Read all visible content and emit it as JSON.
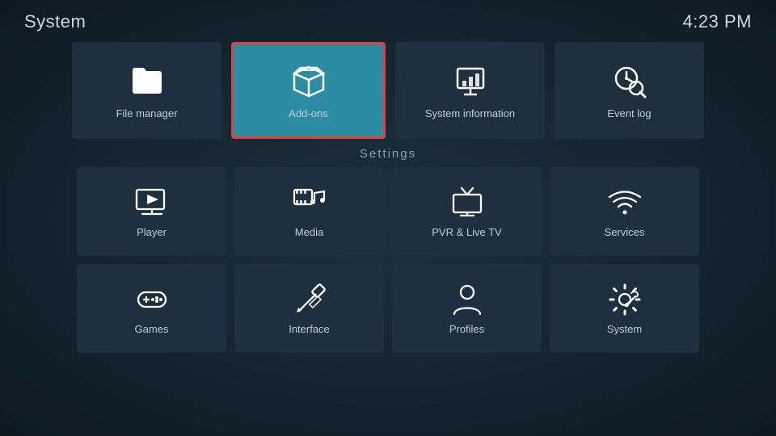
{
  "header": {
    "title": "System",
    "time": "4:23 PM"
  },
  "top_row": {
    "items": [
      {
        "id": "file-manager",
        "label": "File manager"
      },
      {
        "id": "add-ons",
        "label": "Add-ons"
      },
      {
        "id": "system-information",
        "label": "System information"
      },
      {
        "id": "event-log",
        "label": "Event log"
      }
    ]
  },
  "settings": {
    "section_label": "Settings",
    "row1": [
      {
        "id": "player",
        "label": "Player"
      },
      {
        "id": "media",
        "label": "Media"
      },
      {
        "id": "pvr-live-tv",
        "label": "PVR & Live TV"
      },
      {
        "id": "services",
        "label": "Services"
      }
    ],
    "row2": [
      {
        "id": "games",
        "label": "Games"
      },
      {
        "id": "interface",
        "label": "Interface"
      },
      {
        "id": "profiles",
        "label": "Profiles"
      },
      {
        "id": "system",
        "label": "System"
      }
    ]
  }
}
